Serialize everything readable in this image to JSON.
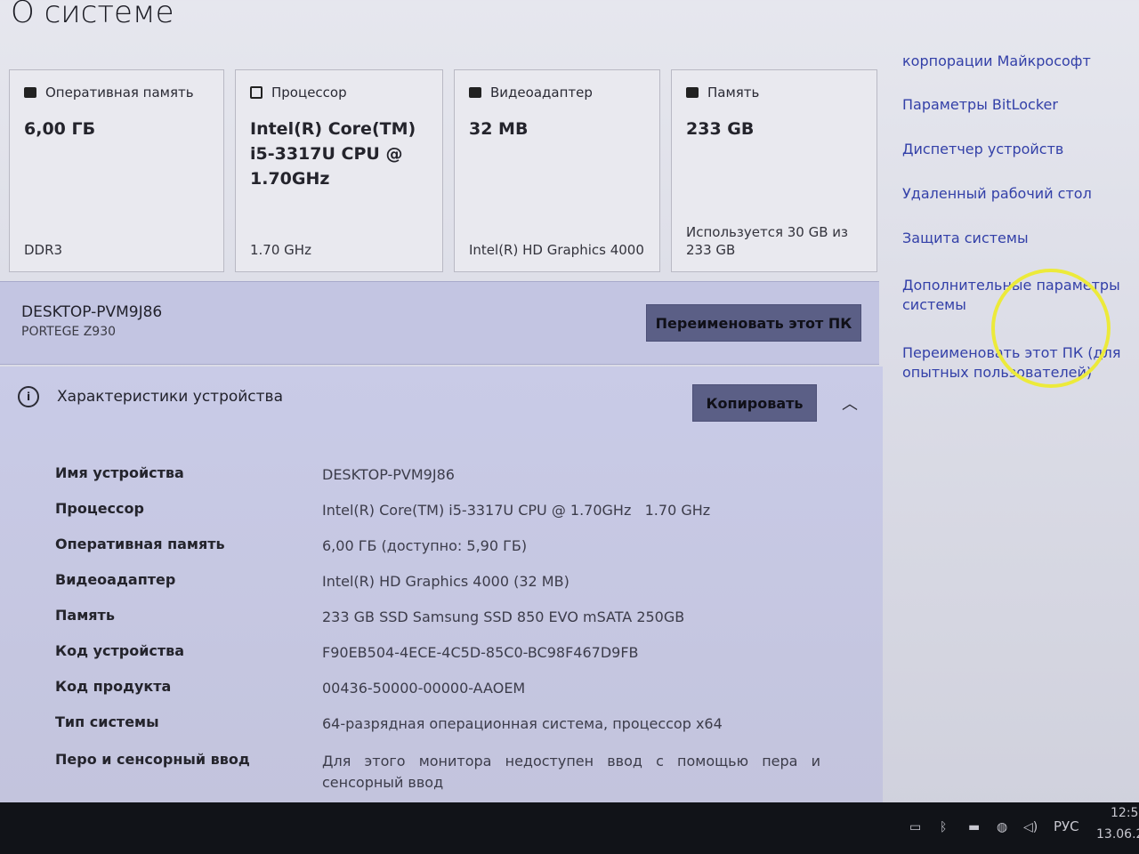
{
  "page": {
    "title": "О системе"
  },
  "cards": [
    {
      "icon": "ram-icon",
      "label": "Оперативная память",
      "value": "6,00 ГБ",
      "foot": "DDR3"
    },
    {
      "icon": "cpu-icon",
      "label": "Процессор",
      "value": "Intel(R) Core(TM) i5-3317U CPU @ 1.70GHz",
      "foot": "1.70 GHz"
    },
    {
      "icon": "gpu-icon",
      "label": "Видеоадаптер",
      "value": "32 MB",
      "foot": "Intel(R) HD Graphics 4000"
    },
    {
      "icon": "storage-icon",
      "label": "Память",
      "value": "233 GB",
      "foot": "Используется 30 GB из 233 GB"
    }
  ],
  "pc": {
    "name": "DESKTOP-PVM9J86",
    "model": "PORTEGE Z930",
    "rename_label": "Переименовать этот ПК"
  },
  "specs": {
    "heading": "Характеристики устройства",
    "copy_label": "Копировать",
    "rows": [
      {
        "label": "Имя устройства",
        "value": "DESKTOP-PVM9J86"
      },
      {
        "label": "Процессор",
        "value": "Intel(R) Core(TM) i5-3317U CPU @ 1.70GHz   1.70 GHz"
      },
      {
        "label": "Оперативная память",
        "value": "6,00 ГБ (доступно: 5,90 ГБ)"
      },
      {
        "label": "Видеоадаптер",
        "value": "Intel(R) HD Graphics 4000 (32 MB)"
      },
      {
        "label": "Память",
        "value": "233 GB SSD Samsung SSD 850 EVO mSATA 250GB"
      },
      {
        "label": "Код устройства",
        "value": "F90EB504-4ECE-4C5D-85C0-BC98F467D9FB"
      },
      {
        "label": "Код продукта",
        "value": "00436-50000-00000-AAOEM"
      },
      {
        "label": "Тип системы",
        "value": "64-разрядная операционная система, процессор x64"
      },
      {
        "label": "Перо и сенсорный ввод",
        "value": "Для этого монитора недоступен ввод с помощью пера и сенсорный ввод"
      }
    ]
  },
  "sidebar": {
    "links": [
      "корпорации Майкрософт",
      "Параметры BitLocker",
      "Диспетчер устройств",
      "Удаленный рабочий стол",
      "Защита системы",
      "Дополнительные параметры системы",
      "Переименовать этот ПК (для опытных пользователей)"
    ]
  },
  "taskbar": {
    "lang": "РУС",
    "time": "12:5",
    "date": "13.06.2"
  }
}
